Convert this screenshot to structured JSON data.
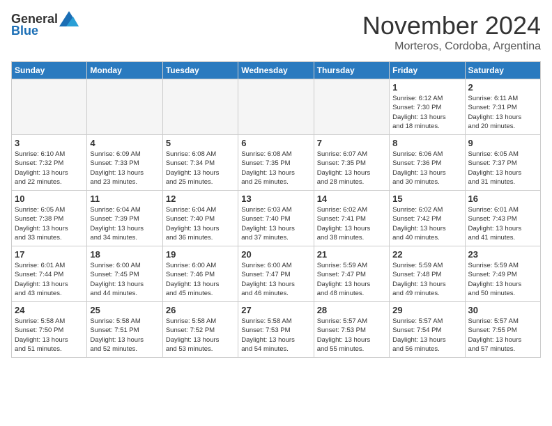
{
  "header": {
    "logo_general": "General",
    "logo_blue": "Blue",
    "month_title": "November 2024",
    "location": "Morteros, Cordoba, Argentina"
  },
  "weekdays": [
    "Sunday",
    "Monday",
    "Tuesday",
    "Wednesday",
    "Thursday",
    "Friday",
    "Saturday"
  ],
  "weeks": [
    [
      {
        "day": "",
        "info": ""
      },
      {
        "day": "",
        "info": ""
      },
      {
        "day": "",
        "info": ""
      },
      {
        "day": "",
        "info": ""
      },
      {
        "day": "",
        "info": ""
      },
      {
        "day": "1",
        "info": "Sunrise: 6:12 AM\nSunset: 7:30 PM\nDaylight: 13 hours\nand 18 minutes."
      },
      {
        "day": "2",
        "info": "Sunrise: 6:11 AM\nSunset: 7:31 PM\nDaylight: 13 hours\nand 20 minutes."
      }
    ],
    [
      {
        "day": "3",
        "info": "Sunrise: 6:10 AM\nSunset: 7:32 PM\nDaylight: 13 hours\nand 22 minutes."
      },
      {
        "day": "4",
        "info": "Sunrise: 6:09 AM\nSunset: 7:33 PM\nDaylight: 13 hours\nand 23 minutes."
      },
      {
        "day": "5",
        "info": "Sunrise: 6:08 AM\nSunset: 7:34 PM\nDaylight: 13 hours\nand 25 minutes."
      },
      {
        "day": "6",
        "info": "Sunrise: 6:08 AM\nSunset: 7:35 PM\nDaylight: 13 hours\nand 26 minutes."
      },
      {
        "day": "7",
        "info": "Sunrise: 6:07 AM\nSunset: 7:35 PM\nDaylight: 13 hours\nand 28 minutes."
      },
      {
        "day": "8",
        "info": "Sunrise: 6:06 AM\nSunset: 7:36 PM\nDaylight: 13 hours\nand 30 minutes."
      },
      {
        "day": "9",
        "info": "Sunrise: 6:05 AM\nSunset: 7:37 PM\nDaylight: 13 hours\nand 31 minutes."
      }
    ],
    [
      {
        "day": "10",
        "info": "Sunrise: 6:05 AM\nSunset: 7:38 PM\nDaylight: 13 hours\nand 33 minutes."
      },
      {
        "day": "11",
        "info": "Sunrise: 6:04 AM\nSunset: 7:39 PM\nDaylight: 13 hours\nand 34 minutes."
      },
      {
        "day": "12",
        "info": "Sunrise: 6:04 AM\nSunset: 7:40 PM\nDaylight: 13 hours\nand 36 minutes."
      },
      {
        "day": "13",
        "info": "Sunrise: 6:03 AM\nSunset: 7:40 PM\nDaylight: 13 hours\nand 37 minutes."
      },
      {
        "day": "14",
        "info": "Sunrise: 6:02 AM\nSunset: 7:41 PM\nDaylight: 13 hours\nand 38 minutes."
      },
      {
        "day": "15",
        "info": "Sunrise: 6:02 AM\nSunset: 7:42 PM\nDaylight: 13 hours\nand 40 minutes."
      },
      {
        "day": "16",
        "info": "Sunrise: 6:01 AM\nSunset: 7:43 PM\nDaylight: 13 hours\nand 41 minutes."
      }
    ],
    [
      {
        "day": "17",
        "info": "Sunrise: 6:01 AM\nSunset: 7:44 PM\nDaylight: 13 hours\nand 43 minutes."
      },
      {
        "day": "18",
        "info": "Sunrise: 6:00 AM\nSunset: 7:45 PM\nDaylight: 13 hours\nand 44 minutes."
      },
      {
        "day": "19",
        "info": "Sunrise: 6:00 AM\nSunset: 7:46 PM\nDaylight: 13 hours\nand 45 minutes."
      },
      {
        "day": "20",
        "info": "Sunrise: 6:00 AM\nSunset: 7:47 PM\nDaylight: 13 hours\nand 46 minutes."
      },
      {
        "day": "21",
        "info": "Sunrise: 5:59 AM\nSunset: 7:47 PM\nDaylight: 13 hours\nand 48 minutes."
      },
      {
        "day": "22",
        "info": "Sunrise: 5:59 AM\nSunset: 7:48 PM\nDaylight: 13 hours\nand 49 minutes."
      },
      {
        "day": "23",
        "info": "Sunrise: 5:59 AM\nSunset: 7:49 PM\nDaylight: 13 hours\nand 50 minutes."
      }
    ],
    [
      {
        "day": "24",
        "info": "Sunrise: 5:58 AM\nSunset: 7:50 PM\nDaylight: 13 hours\nand 51 minutes."
      },
      {
        "day": "25",
        "info": "Sunrise: 5:58 AM\nSunset: 7:51 PM\nDaylight: 13 hours\nand 52 minutes."
      },
      {
        "day": "26",
        "info": "Sunrise: 5:58 AM\nSunset: 7:52 PM\nDaylight: 13 hours\nand 53 minutes."
      },
      {
        "day": "27",
        "info": "Sunrise: 5:58 AM\nSunset: 7:53 PM\nDaylight: 13 hours\nand 54 minutes."
      },
      {
        "day": "28",
        "info": "Sunrise: 5:57 AM\nSunset: 7:53 PM\nDaylight: 13 hours\nand 55 minutes."
      },
      {
        "day": "29",
        "info": "Sunrise: 5:57 AM\nSunset: 7:54 PM\nDaylight: 13 hours\nand 56 minutes."
      },
      {
        "day": "30",
        "info": "Sunrise: 5:57 AM\nSunset: 7:55 PM\nDaylight: 13 hours\nand 57 minutes."
      }
    ]
  ]
}
